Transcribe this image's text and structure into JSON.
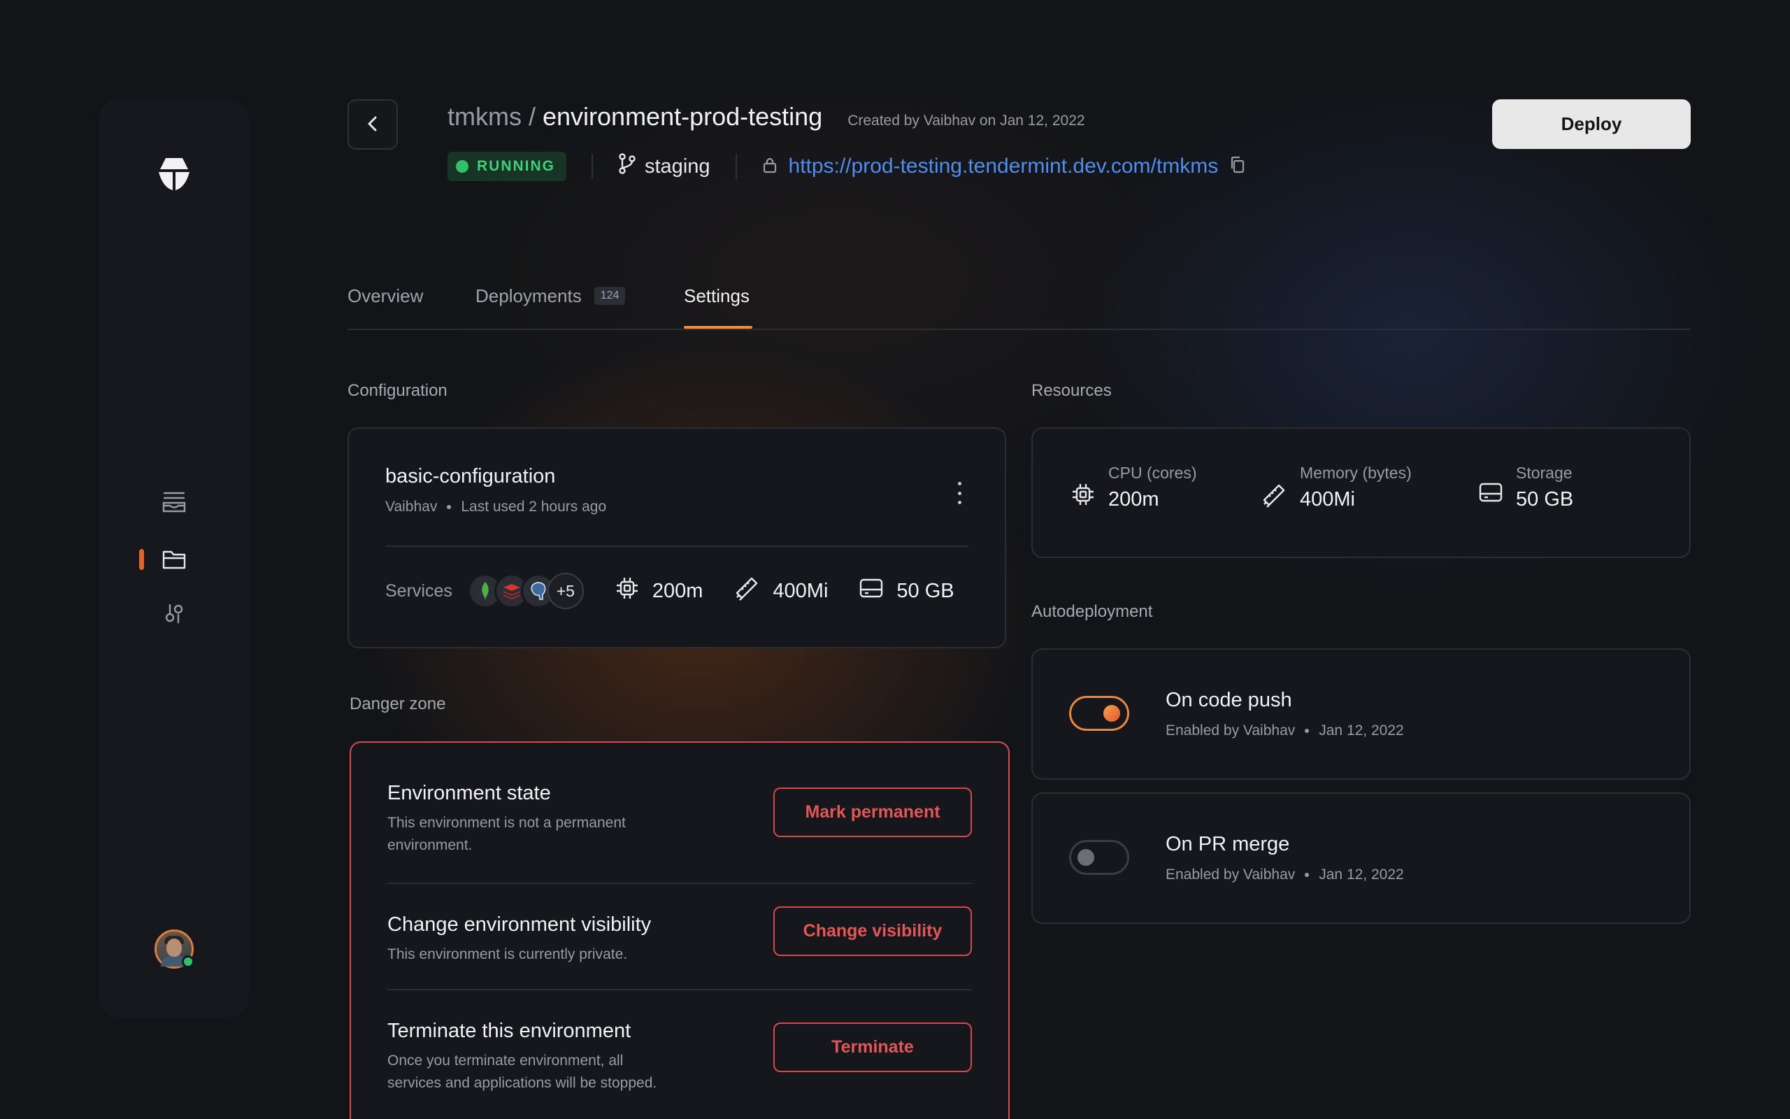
{
  "header": {
    "project": "tmkms",
    "separator": "/",
    "environment": "environment-prod-testing",
    "created": "Created by Vaibhav on Jan 12, 2022",
    "status": "RUNNING",
    "branch": "staging",
    "url": "https://prod-testing.tendermint.dev.com/tmkms",
    "deploy_label": "Deploy"
  },
  "tabs": [
    {
      "label": "Overview"
    },
    {
      "label": "Deployments",
      "count": "124"
    },
    {
      "label": "Settings",
      "active": true
    }
  ],
  "configuration": {
    "section_label": "Configuration",
    "name": "basic-configuration",
    "owner": "Vaibhav",
    "last_used": "Last used 2 hours ago",
    "services_label": "Services",
    "services_icons": [
      "mongodb-icon",
      "redis-icon",
      "postgres-icon"
    ],
    "services_more": "+5",
    "cpu": "200m",
    "memory": "400Mi",
    "storage": "50 GB"
  },
  "resources": {
    "section_label": "Resources",
    "items": [
      {
        "label": "CPU (cores)",
        "value": "200m",
        "icon": "cpu-icon"
      },
      {
        "label": "Memory (bytes)",
        "value": "400Mi",
        "icon": "memory-icon"
      },
      {
        "label": "Storage",
        "value": "50 GB",
        "icon": "storage-icon"
      }
    ]
  },
  "autodeployment": {
    "section_label": "Autodeployment",
    "items": [
      {
        "title": "On code push",
        "enabled_by": "Enabled by Vaibhav",
        "date": "Jan 12, 2022",
        "enabled": true
      },
      {
        "title": "On PR merge",
        "enabled_by": "Enabled by Vaibhav",
        "date": "Jan 12, 2022",
        "enabled": false
      }
    ]
  },
  "danger_zone": {
    "section_label": "Danger zone",
    "items": [
      {
        "title": "Environment state",
        "description": "This environment is not a permanent environment.",
        "button": "Mark permanent"
      },
      {
        "title": "Change environment visibility",
        "description": "This environment is currently private.",
        "button": "Change visibility"
      },
      {
        "title": "Terminate this environment",
        "description": "Once you terminate environment, all services and applications will be stopped.",
        "button": "Terminate"
      }
    ]
  },
  "colors": {
    "accent": "#f08a3c",
    "link": "#4d8ef0",
    "running": "#2fc26b",
    "danger": "#d64a4a",
    "deploy_button": "#e8e8e9"
  }
}
